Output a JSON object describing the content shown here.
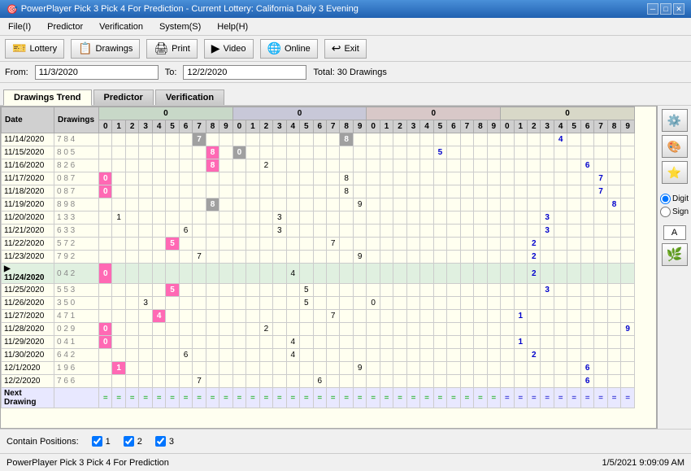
{
  "titlebar": {
    "title": "PowerPlayer Pick 3 Pick 4 For Prediction - Current Lottery: California Daily 3 Evening",
    "icon": "🎯"
  },
  "menubar": {
    "items": [
      "File(I)",
      "Predictor",
      "Verification",
      "System(S)",
      "Help(H)"
    ]
  },
  "toolbar": {
    "buttons": [
      {
        "label": "Lottery",
        "icon": "🎫"
      },
      {
        "label": "Drawings",
        "icon": "📋"
      },
      {
        "label": "Print",
        "icon": "🖨"
      },
      {
        "label": "Video",
        "icon": "▶"
      },
      {
        "label": "Online",
        "icon": "🌐"
      },
      {
        "label": "Exit",
        "icon": "↩"
      }
    ]
  },
  "datebar": {
    "from_label": "From:",
    "from_value": "11/3/2020",
    "to_label": "To:",
    "to_value": "12/2/2020",
    "total": "Total: 30 Drawings"
  },
  "tabs": [
    {
      "label": "Drawings Trend",
      "active": true
    },
    {
      "label": "Predictor",
      "active": false
    },
    {
      "label": "Verification",
      "active": false
    }
  ],
  "table": {
    "headers": {
      "date": "Date",
      "drawings": "Drawings",
      "groups": [
        {
          "label": "0",
          "cols": [
            "0",
            "1",
            "2",
            "3",
            "4",
            "5",
            "6",
            "7",
            "8",
            "9"
          ]
        },
        {
          "label": "0",
          "cols": [
            "0",
            "1",
            "2",
            "3",
            "4",
            "5",
            "6",
            "7",
            "8",
            "9"
          ]
        },
        {
          "label": "0",
          "cols": [
            "0",
            "1",
            "2",
            "3",
            "4",
            "5",
            "6",
            "7",
            "8",
            "9"
          ]
        },
        {
          "label": "0",
          "cols": [
            "0",
            "1",
            "2",
            "3",
            "4",
            "5",
            "6",
            "7",
            "8",
            "9"
          ]
        }
      ],
      "col_numbers": [
        "0",
        "1",
        "2",
        "3",
        "4",
        "5",
        "6",
        "7",
        "8",
        "9",
        "0",
        "1",
        "2",
        "3",
        "4",
        "5",
        "6",
        "7",
        "8",
        "9",
        "0",
        "1",
        "2",
        "3",
        "4",
        "5",
        "6",
        "7",
        "8",
        "9",
        "0",
        "1",
        "2",
        "3",
        "4",
        "5",
        "6",
        "7",
        "8",
        "9"
      ]
    },
    "rows": [
      {
        "date": "11/14/2020",
        "drawings": "7 8 4",
        "cells": {
          "c7_2": "7",
          "c8_1": "8",
          "c4_0": "4"
        }
      },
      {
        "date": "11/15/2020",
        "drawings": "8 0 5",
        "cells": {
          "c8_2_pink": "8",
          "c0_1_gray": "0",
          "c5_0": "5"
        }
      },
      {
        "date": "11/16/2020",
        "drawings": "8 2 6",
        "cells": {
          "c8_2_pink": "8",
          "c2_1": "2",
          "c6_0": "6"
        }
      },
      {
        "date": "11/17/2020",
        "drawings": "0 8 7",
        "cells": {
          "c0_2_pink": "0",
          "c8_1": "8",
          "c7_0": "7"
        }
      },
      {
        "date": "11/18/2020",
        "drawings": "0 8 7",
        "cells": {
          "c0_2_pink": "0",
          "c8_1": "8",
          "c7_0": "7"
        }
      },
      {
        "date": "11/19/2020",
        "drawings": "8 9 8",
        "cells": {
          "c8_2_gray": "8",
          "c9_1": "9",
          "c8_0": "8"
        }
      },
      {
        "date": "11/20/2020",
        "drawings": "1 3 3",
        "cells": {
          "c1_2": "1",
          "c3_1": "3",
          "c3_0": "3"
        }
      },
      {
        "date": "11/21/2020",
        "drawings": "6 3 3",
        "cells": {
          "c6_2": "6",
          "c3_1": "3",
          "c3_0": "3"
        }
      },
      {
        "date": "11/22/2020",
        "drawings": "5 7 2",
        "cells": {
          "c5_2": "5",
          "c7_1": "7",
          "c2_0": "2"
        }
      },
      {
        "date": "11/23/2020",
        "drawings": "7 9 2",
        "cells": {
          "c7_2": "7",
          "c9_1": "9",
          "c2_0": "2"
        }
      },
      {
        "date": "11/24/2020",
        "drawings": "0 4 2",
        "cells": {
          "c0_2_pink": "0",
          "c4_1": "4",
          "c2_0": "2"
        },
        "current": true
      },
      {
        "date": "11/25/2020",
        "drawings": "5 5 3",
        "cells": {
          "c5_2": "5",
          "c5_1": "5",
          "c3_0": "3"
        }
      },
      {
        "date": "11/26/2020",
        "drawings": "3 5 0",
        "cells": {
          "c3_2": "3",
          "c5_1": "5",
          "c0_0": "0"
        }
      },
      {
        "date": "11/27/2020",
        "drawings": "4 7 1",
        "cells": {
          "c4_2": "4",
          "c7_1": "7",
          "c1_0": "1"
        }
      },
      {
        "date": "11/28/2020",
        "drawings": "0 2 9",
        "cells": {
          "c0_2_pink": "0",
          "c2_1": "2",
          "c9_0": "9"
        }
      },
      {
        "date": "11/29/2020",
        "drawings": "0 4 1",
        "cells": {
          "c0_2_pink": "0",
          "c4_1": "4",
          "c1_0": "1"
        }
      },
      {
        "date": "11/30/2020",
        "drawings": "6 4 2",
        "cells": {
          "c6_2": "6",
          "c4_1": "4",
          "c2_0": "2"
        }
      },
      {
        "date": "12/1/2020",
        "drawings": "1 9 6",
        "cells": {
          "c1_2_pink": "1",
          "c9_1": "9",
          "c6_0": "6"
        }
      },
      {
        "date": "12/2/2020",
        "drawings": "7 6 6",
        "cells": {
          "c7_2": "7",
          "c6_1": "6",
          "c6_0": "6"
        }
      }
    ]
  },
  "right_panel": {
    "digit_label": "Digit",
    "sign_label": "Sign",
    "letter": "A"
  },
  "bottom_bar": {
    "label": "Contain Positions:",
    "positions": [
      {
        "checked": true,
        "label": "1"
      },
      {
        "checked": true,
        "label": "2"
      },
      {
        "checked": true,
        "label": "3"
      }
    ]
  },
  "statusbar": {
    "left": "PowerPlayer Pick 3 Pick 4 For Prediction",
    "right": "1/5/2021  9:09:09 AM"
  },
  "winbtns": {
    "minimize": "─",
    "maximize": "□",
    "close": "✕"
  }
}
